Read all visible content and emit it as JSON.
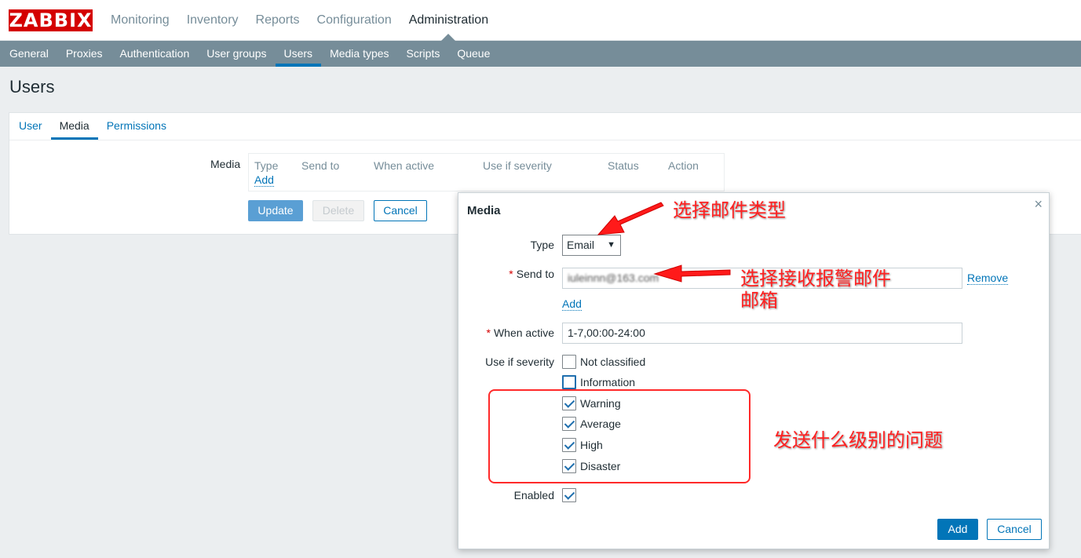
{
  "app": {
    "logo": "ZABBIX",
    "main_menu": [
      "Monitoring",
      "Inventory",
      "Reports",
      "Configuration",
      "Administration"
    ],
    "sub_menu": [
      "General",
      "Proxies",
      "Authentication",
      "User groups",
      "Users",
      "Media types",
      "Scripts",
      "Queue"
    ]
  },
  "page": {
    "title": "Users",
    "tabs": [
      "User",
      "Media",
      "Permissions"
    ],
    "media_label": "Media",
    "media_table": {
      "headers": [
        "Type",
        "Send to",
        "When active",
        "Use if severity",
        "Status",
        "Action"
      ],
      "add_link": "Add"
    },
    "buttons": {
      "update": "Update",
      "delete": "Delete",
      "cancel": "Cancel"
    }
  },
  "dialog": {
    "title": "Media",
    "close": "×",
    "type_label": "Type",
    "type_value": "Email",
    "send_to_label": "Send to",
    "send_to_value": "iuleinnn@163.com",
    "remove_link": "Remove",
    "add_link": "Add",
    "when_active_label": "When active",
    "when_active_value": "1-7,00:00-24:00",
    "severity_label": "Use if severity",
    "severities": [
      {
        "label": "Not classified",
        "checked": false
      },
      {
        "label": "Information",
        "checked": false
      },
      {
        "label": "Warning",
        "checked": true
      },
      {
        "label": "Average",
        "checked": true
      },
      {
        "label": "High",
        "checked": true
      },
      {
        "label": "Disaster",
        "checked": true
      }
    ],
    "enabled_label": "Enabled",
    "enabled": true,
    "add_button": "Add",
    "cancel_button": "Cancel"
  },
  "annotations": {
    "select_type": "选择邮件类型",
    "send_to_line1": "选择接收报警邮件",
    "send_to_line2": "邮箱",
    "severity": "发送什么级别的问题",
    "color": "#ff2020"
  }
}
